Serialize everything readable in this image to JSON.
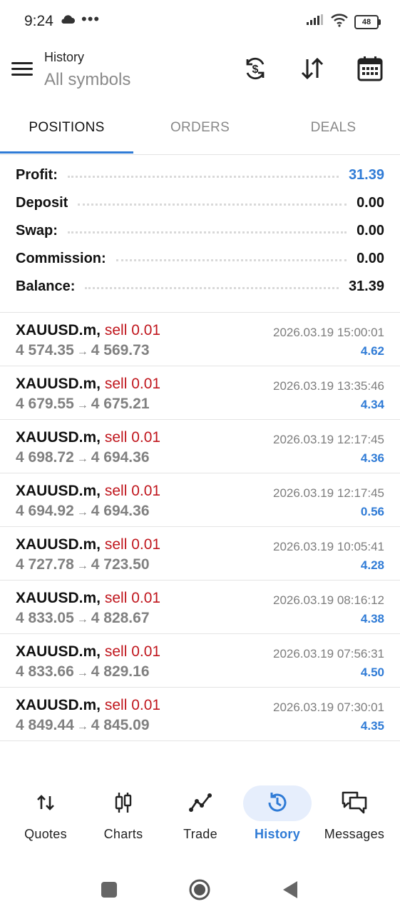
{
  "status_bar": {
    "time": "9:24",
    "more": "•••",
    "battery": "48"
  },
  "app_bar": {
    "subtitle": "History",
    "title": "All symbols",
    "icons": [
      "menu-icon",
      "sync-currency-icon",
      "sort-icon",
      "calendar-icon"
    ]
  },
  "tabs": [
    {
      "label": "POSITIONS",
      "active": true
    },
    {
      "label": "ORDERS",
      "active": false
    },
    {
      "label": "DEALS",
      "active": false
    }
  ],
  "summary": [
    {
      "label": "Profit:",
      "value": "31.39",
      "highlight": true
    },
    {
      "label": "Deposit",
      "value": "0.00",
      "highlight": false
    },
    {
      "label": "Swap:",
      "value": "0.00",
      "highlight": false
    },
    {
      "label": "Commission:",
      "value": "0.00",
      "highlight": false
    },
    {
      "label": "Balance:",
      "value": "31.39",
      "highlight": false
    }
  ],
  "deals": [
    {
      "symbol": "XAUUSD.m,",
      "side": "sell 0.01",
      "open": "4 574.35",
      "close": "4 569.73",
      "time": "2026.03.19 15:00:01",
      "profit": "4.62"
    },
    {
      "symbol": "XAUUSD.m,",
      "side": "sell 0.01",
      "open": "4 679.55",
      "close": "4 675.21",
      "time": "2026.03.19 13:35:46",
      "profit": "4.34"
    },
    {
      "symbol": "XAUUSD.m,",
      "side": "sell 0.01",
      "open": "4 698.72",
      "close": "4 694.36",
      "time": "2026.03.19 12:17:45",
      "profit": "4.36"
    },
    {
      "symbol": "XAUUSD.m,",
      "side": "sell 0.01",
      "open": "4 694.92",
      "close": "4 694.36",
      "time": "2026.03.19 12:17:45",
      "profit": "0.56"
    },
    {
      "symbol": "XAUUSD.m,",
      "side": "sell 0.01",
      "open": "4 727.78",
      "close": "4 723.50",
      "time": "2026.03.19 10:05:41",
      "profit": "4.28"
    },
    {
      "symbol": "XAUUSD.m,",
      "side": "sell 0.01",
      "open": "4 833.05",
      "close": "4 828.67",
      "time": "2026.03.19 08:16:12",
      "profit": "4.38"
    },
    {
      "symbol": "XAUUSD.m,",
      "side": "sell 0.01",
      "open": "4 833.66",
      "close": "4 829.16",
      "time": "2026.03.19 07:56:31",
      "profit": "4.50"
    },
    {
      "symbol": "XAUUSD.m,",
      "side": "sell 0.01",
      "open": "4 849.44",
      "close": "4 845.09",
      "time": "2026.03.19 07:30:01",
      "profit": "4.35"
    }
  ],
  "arrow": "→",
  "bottom_nav": [
    {
      "label": "Quotes",
      "icon": "quotes-icon",
      "active": false
    },
    {
      "label": "Charts",
      "icon": "candlestick-icon",
      "active": false
    },
    {
      "label": "Trade",
      "icon": "trend-line-icon",
      "active": false
    },
    {
      "label": "History",
      "icon": "history-clock-icon",
      "active": true
    },
    {
      "label": "Messages",
      "icon": "chat-bubbles-icon",
      "active": false
    }
  ],
  "colors": {
    "accent": "#2f7bd6",
    "sell": "#c0161d",
    "muted": "#808080"
  }
}
